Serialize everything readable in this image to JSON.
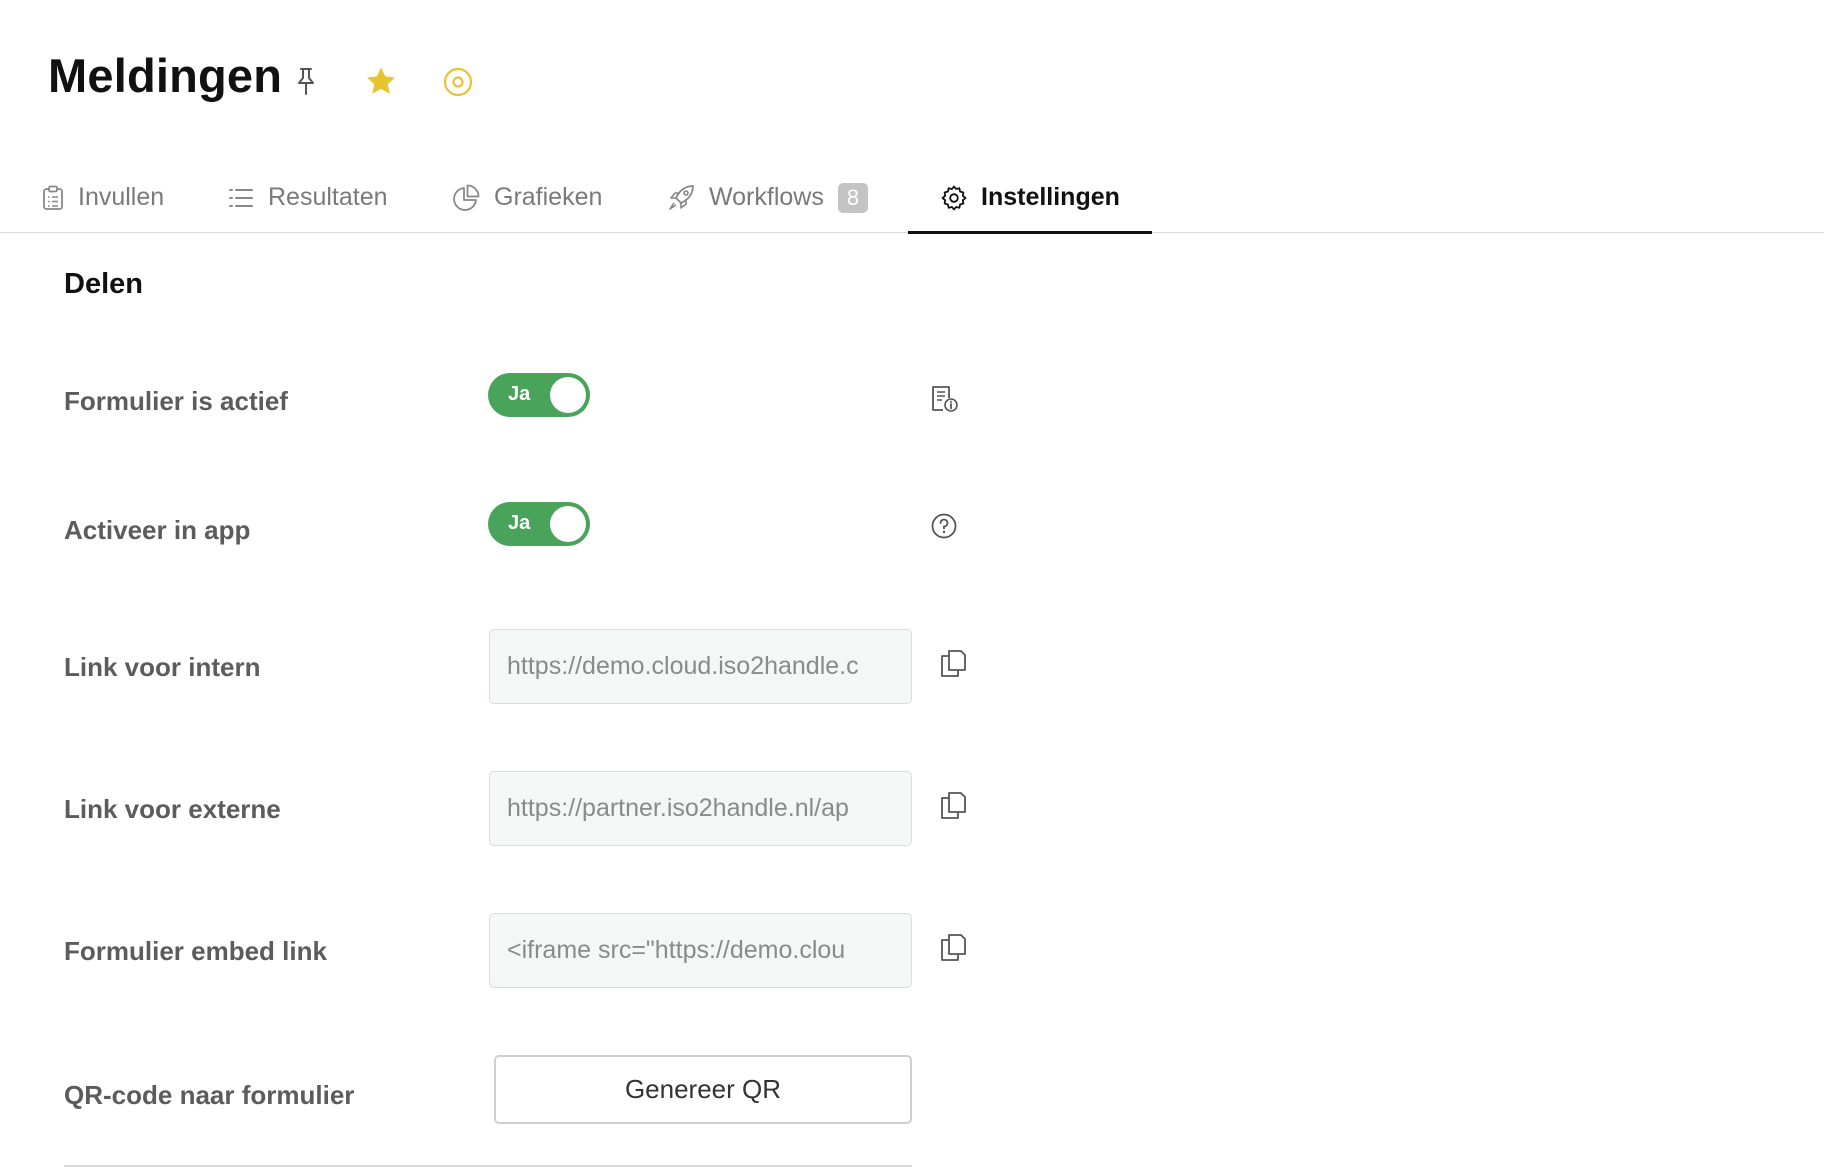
{
  "page": {
    "title": "Meldingen"
  },
  "header_icons": {
    "pin": "pin-icon",
    "favorite": "star-icon",
    "status": "target-icon",
    "favorite_color": "#e8c432"
  },
  "tabs": [
    {
      "label": "Invullen",
      "icon": "clipboard-icon"
    },
    {
      "label": "Resultaten",
      "icon": "list-icon"
    },
    {
      "label": "Grafieken",
      "icon": "pie-chart-icon"
    },
    {
      "label": "Workflows",
      "icon": "rocket-icon",
      "badge": "8"
    },
    {
      "label": "Instellingen",
      "icon": "gear-icon",
      "active": true
    }
  ],
  "section": {
    "title": "Delen"
  },
  "settings": {
    "form_active": {
      "label": "Formulier is actief",
      "toggle": "Ja",
      "icon": "document-info-icon"
    },
    "app_active": {
      "label": "Activeer in app",
      "toggle": "Ja",
      "icon": "help-circle-icon"
    },
    "internal_link": {
      "label": "Link voor intern",
      "value": "https://demo.cloud.iso2handle.c",
      "icon": "copy-icon"
    },
    "external_link": {
      "label": "Link voor externe",
      "value": "https://partner.iso2handle.nl/ap",
      "icon": "copy-icon"
    },
    "embed_link": {
      "label": "Formulier embed link",
      "value": "<iframe src=\"https://demo.clou",
      "icon": "copy-icon"
    },
    "qr": {
      "label": "QR-code naar formulier",
      "button": "Genereer QR"
    }
  },
  "colors": {
    "toggle_on": "#4aa35b",
    "badge": "#c4c4c4",
    "accent_yellow": "#e8c432"
  }
}
